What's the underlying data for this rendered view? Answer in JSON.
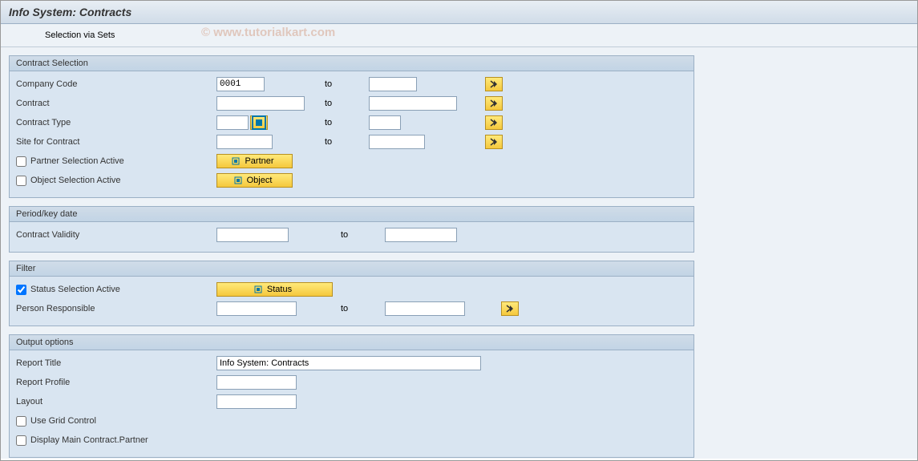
{
  "title": "Info System: Contracts",
  "toolbar": {
    "selection_via_sets": "Selection via Sets"
  },
  "watermark": "©  www.tutorialkart.com",
  "groups": {
    "contract_selection": {
      "title": "Contract Selection",
      "company_code": {
        "label": "Company Code",
        "to": "to",
        "from_value": "0001",
        "to_value": ""
      },
      "contract": {
        "label": "Contract",
        "to": "to",
        "from_value": "",
        "to_value": ""
      },
      "contract_type": {
        "label": "Contract Type",
        "to": "to",
        "from_value": "",
        "to_value": ""
      },
      "site": {
        "label": "Site for Contract",
        "to": "to",
        "from_value": "",
        "to_value": ""
      },
      "partner_selection": {
        "label": "Partner Selection Active",
        "button": "Partner",
        "checked": false
      },
      "object_selection": {
        "label": "Object Selection Active",
        "button": "Object",
        "checked": false
      }
    },
    "period": {
      "title": "Period/key date",
      "contract_validity": {
        "label": "Contract Validity",
        "to": "to",
        "from_value": "",
        "to_value": ""
      }
    },
    "filter": {
      "title": "Filter",
      "status_selection": {
        "label": "Status Selection Active",
        "button": "Status",
        "checked": true
      },
      "person_responsible": {
        "label": "Person Responsible",
        "to": "to",
        "from_value": "",
        "to_value": ""
      }
    },
    "output": {
      "title": "Output options",
      "report_title": {
        "label": "Report Title",
        "value": "Info System: Contracts"
      },
      "report_profile": {
        "label": "Report Profile",
        "value": ""
      },
      "layout": {
        "label": "Layout",
        "value": ""
      },
      "grid_control": {
        "label": "Use Grid Control",
        "checked": false
      },
      "main_partner": {
        "label": "Display Main Contract.Partner",
        "checked": false
      }
    }
  }
}
